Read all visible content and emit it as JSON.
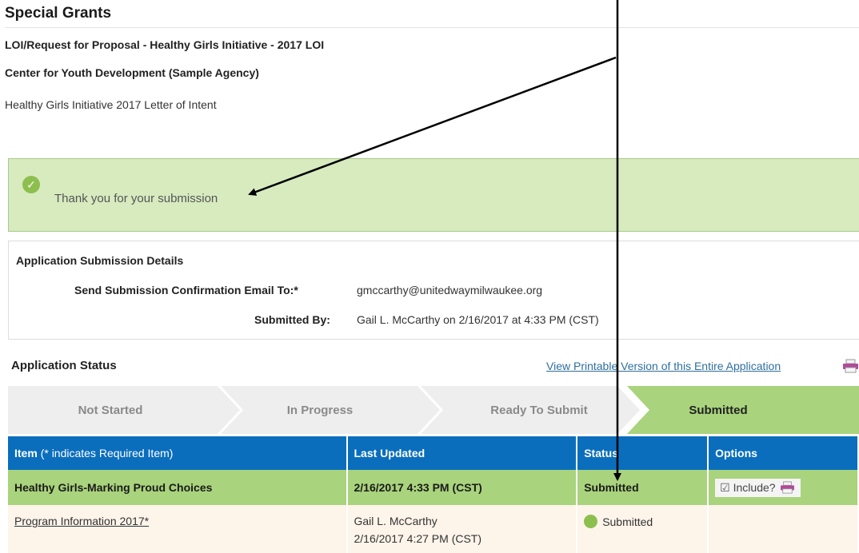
{
  "page": {
    "title": "Special Grants",
    "subtitle": "LOI/Request for Proposal - Healthy Girls Initiative - 2017 LOI",
    "agency": "Center for Youth Development (Sample Agency)",
    "description": "Healthy Girls Initiative 2017 Letter of Intent"
  },
  "success": {
    "icon": "check-circle-icon",
    "message": "Thank you for your submission"
  },
  "details": {
    "heading": "Application Submission Details",
    "email_label": "Send Submission Confirmation Email To:*",
    "email_value": "gmccarthy@unitedwaymilwaukee.org",
    "submitted_by_label": "Submitted By:",
    "submitted_by_value": "Gail L. McCarthy on 2/16/2017 at 4:33 PM (CST)"
  },
  "status": {
    "heading": "Application Status",
    "print_link": "View Printable Version of this Entire Application",
    "steps": [
      "Not Started",
      "In Progress",
      "Ready To Submit",
      "Submitted"
    ],
    "active_step": "Submitted"
  },
  "table": {
    "headers": {
      "item": "Item",
      "item_note": "(* indicates Required Item)",
      "last_updated": "Last Updated",
      "status": "Status",
      "options": "Options"
    },
    "group": {
      "name": "Healthy Girls-Marking Proud Choices",
      "last_updated": "2/16/2017 4:33 PM (CST)",
      "status": "Submitted",
      "include_label": "Include?"
    },
    "item": {
      "name": "Program Information 2017*",
      "updated_by": "Gail L. McCarthy",
      "updated_at": "2/16/2017 4:27 PM (CST)",
      "status": "Submitted"
    }
  },
  "colors": {
    "success_bg": "#d7ebbf",
    "active_step": "#a9d37c",
    "header_blue": "#0a6ebd",
    "link": "#2f6f9f"
  }
}
